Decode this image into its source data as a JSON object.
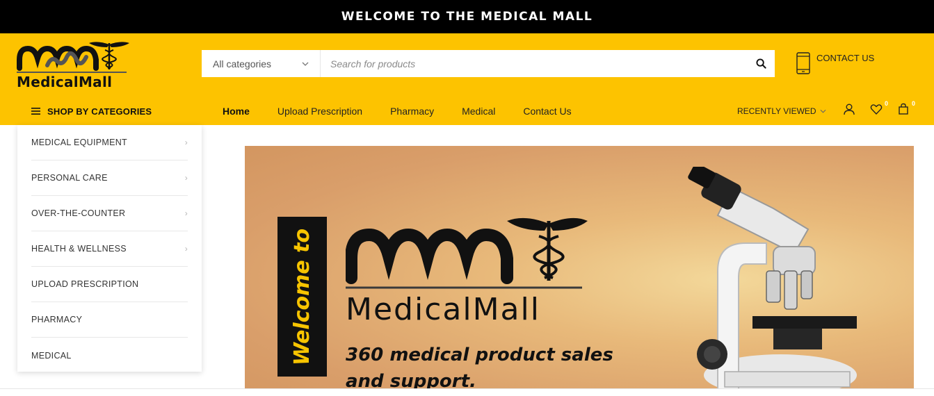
{
  "topbar": {
    "welcome": "WELCOME TO THE MEDICAL MALL"
  },
  "brand": {
    "logo_text": "MedicalMall"
  },
  "search": {
    "category_selected": "All categories",
    "placeholder": "Search for products",
    "value": ""
  },
  "contact": {
    "label": "CONTACT US"
  },
  "shop_by_categories": {
    "label": "SHOP BY CATEGORIES"
  },
  "nav": {
    "items": [
      {
        "label": "Home",
        "active": true
      },
      {
        "label": "Upload Prescription"
      },
      {
        "label": "Pharmacy"
      },
      {
        "label": "Medical"
      },
      {
        "label": "Contact Us"
      }
    ]
  },
  "header_actions": {
    "recently_viewed": "RECENTLY VIEWED",
    "wishlist_count": "0",
    "cart_count": "0"
  },
  "categories": [
    {
      "label": "MEDICAL EQUIPMENT",
      "has_sub": true
    },
    {
      "label": "PERSONAL CARE",
      "has_sub": true
    },
    {
      "label": "OVER-THE-COUNTER",
      "has_sub": true
    },
    {
      "label": "HEALTH & WELLNESS",
      "has_sub": true
    },
    {
      "label": "UPLOAD PRESCRIPTION",
      "has_sub": false
    },
    {
      "label": "PHARMACY",
      "has_sub": false
    },
    {
      "label": "MEDICAL",
      "has_sub": false
    }
  ],
  "banner": {
    "vertical_text": "Welcome to",
    "brand": "MedicalMall",
    "tagline": "360 medical product sales and support."
  },
  "colors": {
    "accent": "#fdc300",
    "topbar": "#000000"
  }
}
